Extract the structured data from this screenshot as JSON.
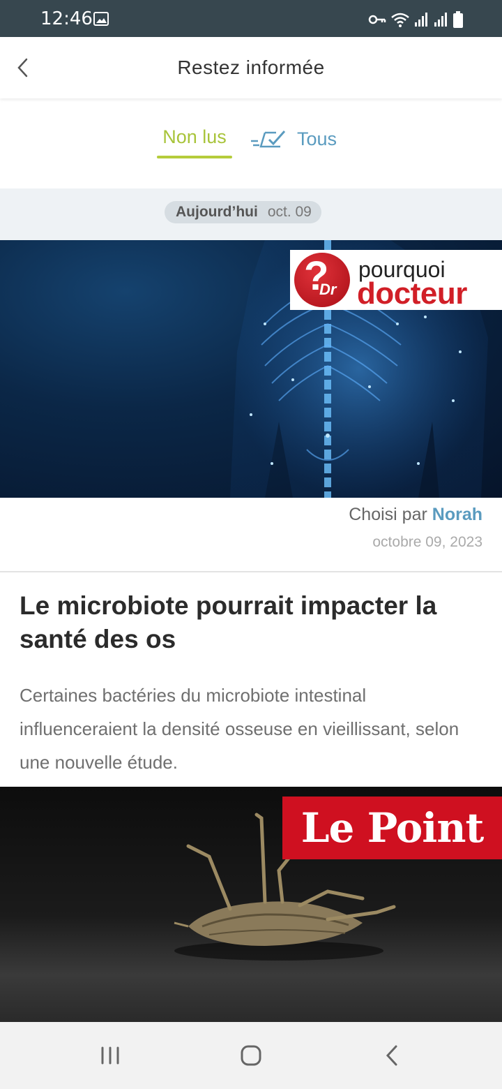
{
  "status_bar": {
    "time": "12:46",
    "icons": [
      "gallery-icon",
      "vpn-key-icon",
      "wifi-icon",
      "signal-icon",
      "signal-icon",
      "battery-icon"
    ]
  },
  "header": {
    "title": "Restez informée",
    "back_icon": "chevron-left-icon"
  },
  "tabs": {
    "unread_label": "Non lus",
    "all_label": "Tous",
    "active": "unread",
    "active_color": "#b5cc3b",
    "inactive_color": "#5a9bbf"
  },
  "date_group": {
    "today_label": "Aujourd’hui",
    "short_date": "oct. 09"
  },
  "articles": [
    {
      "source_logo": {
        "line1": "pourquoi",
        "line2": "docteur",
        "badge_q": "?",
        "badge_dr": "Dr"
      },
      "chosen_by_prefix": "Choisi par",
      "chosen_by_author": "Norah",
      "date": "octobre 09, 2023",
      "title": "Le microbiote pourrait impacter la santé des os",
      "summary": "Certaines bactéries du microbiote intestinal influenceraient la densité osseuse en vieillissant, selon une nouvelle étude."
    },
    {
      "source_logo": {
        "text": "Le Point"
      }
    }
  ],
  "nav_bar": {
    "icons": [
      "recent-apps-icon",
      "home-icon",
      "back-icon"
    ]
  }
}
